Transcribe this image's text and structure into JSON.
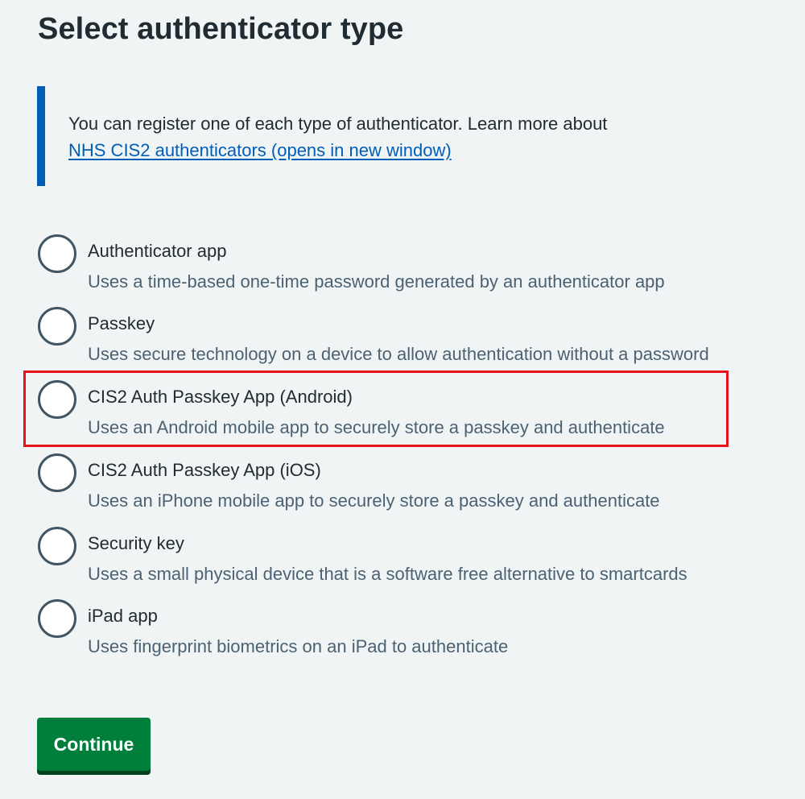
{
  "page": {
    "title": "Select authenticator type"
  },
  "inset": {
    "text": "You can register one of each type of authenticator. Learn more about",
    "link_label": "NHS CIS2 authenticators (opens in new window)",
    "accent_color": "#005eb8"
  },
  "options": [
    {
      "label": "Authenticator app",
      "hint": "Uses a time-based one-time password generated by an authenticator app",
      "selected": false
    },
    {
      "label": "Passkey",
      "hint": "Uses secure technology on a device to allow authentication without a password",
      "selected": false
    },
    {
      "label": "CIS2 Auth Passkey App (Android)",
      "hint": "Uses an Android mobile app to securely store a passkey and authenticate",
      "selected": false,
      "highlighted": true
    },
    {
      "label": "CIS2 Auth Passkey App (iOS)",
      "hint": "Uses an iPhone mobile app to securely store a passkey and authenticate",
      "selected": false
    },
    {
      "label": "Security key",
      "hint": "Uses a small physical device that is a software free alternative to smartcards",
      "selected": false
    },
    {
      "label": "iPad app",
      "hint": "Uses fingerprint biometrics on an iPad to authenticate",
      "selected": false
    }
  ],
  "continue_button": {
    "label": "Continue",
    "color": "#007f3b"
  },
  "colors": {
    "background": "#f0f4f5",
    "text": "#212b32",
    "hint_text": "#4c6272",
    "highlight": "#e8101a"
  }
}
